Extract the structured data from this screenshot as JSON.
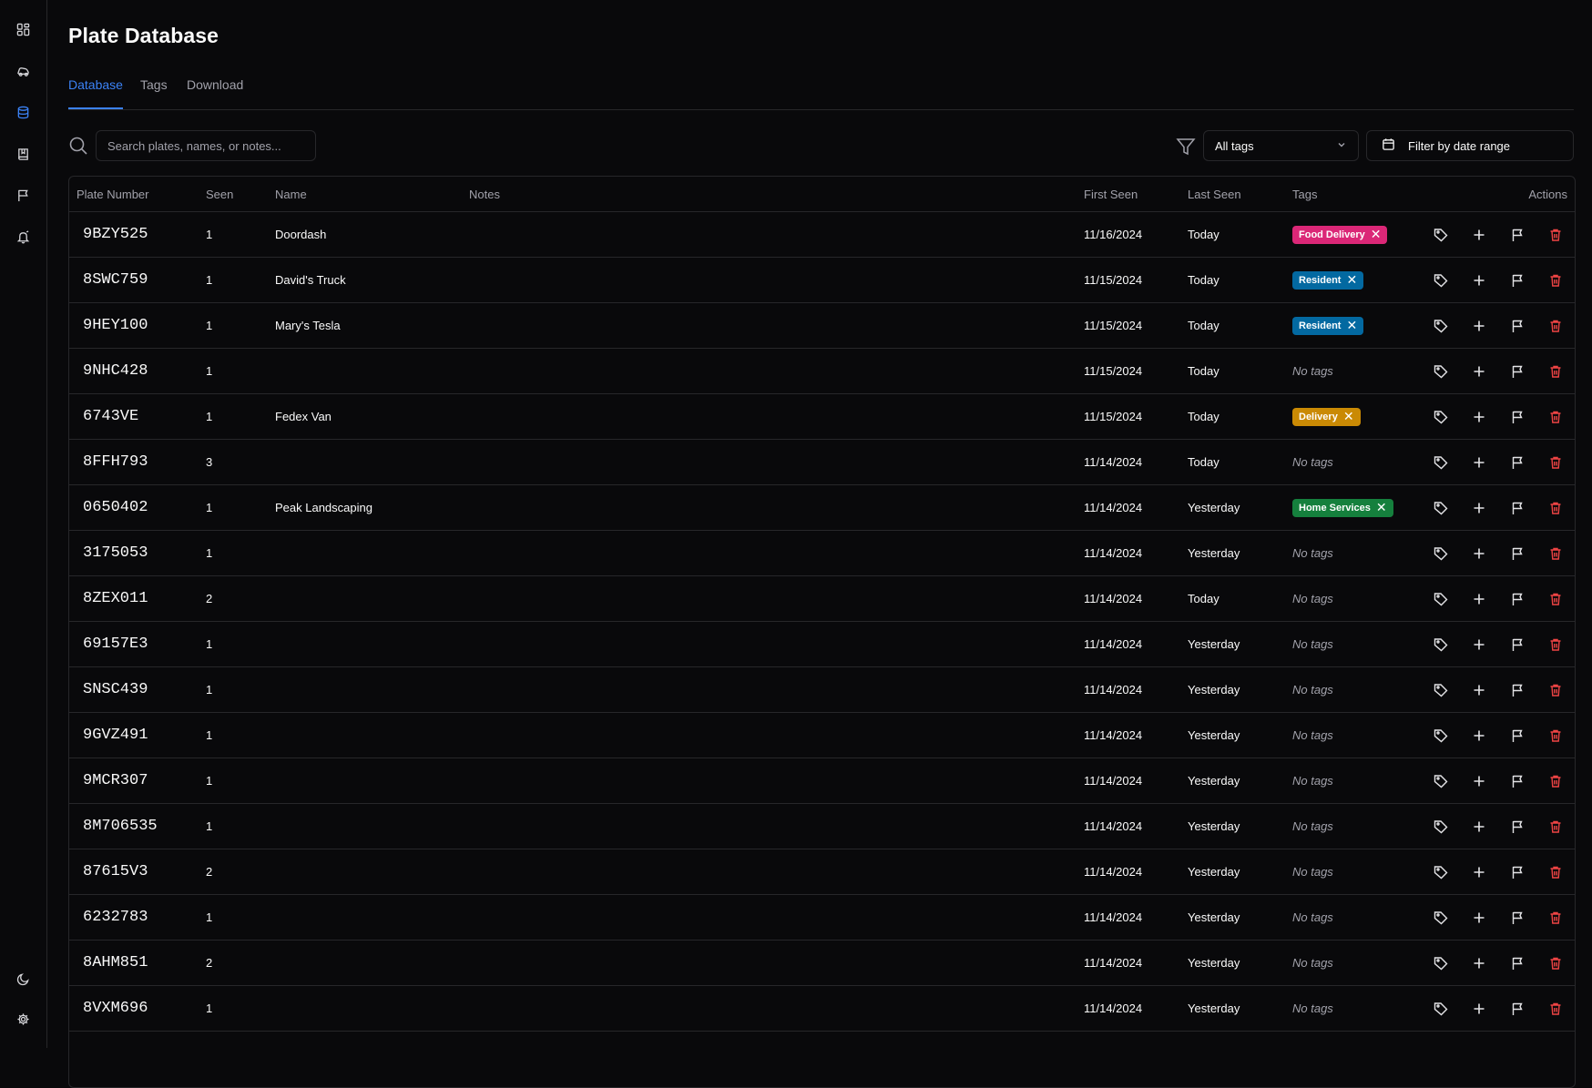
{
  "page": {
    "title": "Plate Database"
  },
  "tabs": [
    {
      "label": "Database",
      "active": true
    },
    {
      "label": "Tags",
      "active": false
    },
    {
      "label": "Download",
      "active": false
    }
  ],
  "search": {
    "placeholder": "Search plates, names, or notes...",
    "value": ""
  },
  "filters": {
    "tag_select_value": "All tags",
    "date_button_label": "Filter by date range"
  },
  "table": {
    "columns": [
      "Plate Number",
      "Seen",
      "Name",
      "Notes",
      "First Seen",
      "Last Seen",
      "Tags",
      "Actions"
    ],
    "no_tags_label": "No tags",
    "rows": [
      {
        "plate": "9BZY525",
        "seen": "1",
        "name": "Doordash",
        "notes": "",
        "first_seen": "11/16/2024",
        "last_seen": "Today",
        "tags": [
          {
            "name": "Food Delivery",
            "color": "#db2777"
          }
        ]
      },
      {
        "plate": "8SWC759",
        "seen": "1",
        "name": "David's Truck",
        "notes": "",
        "first_seen": "11/15/2024",
        "last_seen": "Today",
        "tags": [
          {
            "name": "Resident",
            "color": "#0369a1"
          }
        ]
      },
      {
        "plate": "9HEY100",
        "seen": "1",
        "name": "Mary's Tesla",
        "notes": "",
        "first_seen": "11/15/2024",
        "last_seen": "Today",
        "tags": [
          {
            "name": "Resident",
            "color": "#0369a1"
          }
        ]
      },
      {
        "plate": "9NHC428",
        "seen": "1",
        "name": "",
        "notes": "",
        "first_seen": "11/15/2024",
        "last_seen": "Today",
        "tags": []
      },
      {
        "plate": "6743VE",
        "seen": "1",
        "name": "Fedex Van",
        "notes": "",
        "first_seen": "11/15/2024",
        "last_seen": "Today",
        "tags": [
          {
            "name": "Delivery",
            "color": "#ca8a04"
          }
        ]
      },
      {
        "plate": "8FFH793",
        "seen": "3",
        "name": "",
        "notes": "",
        "first_seen": "11/14/2024",
        "last_seen": "Today",
        "tags": []
      },
      {
        "plate": "0650402",
        "seen": "1",
        "name": "Peak Landscaping",
        "notes": "",
        "first_seen": "11/14/2024",
        "last_seen": "Yesterday",
        "tags": [
          {
            "name": "Home Services",
            "color": "#15803d"
          }
        ]
      },
      {
        "plate": "3175053",
        "seen": "1",
        "name": "",
        "notes": "",
        "first_seen": "11/14/2024",
        "last_seen": "Yesterday",
        "tags": []
      },
      {
        "plate": "8ZEX011",
        "seen": "2",
        "name": "",
        "notes": "",
        "first_seen": "11/14/2024",
        "last_seen": "Today",
        "tags": []
      },
      {
        "plate": "69157E3",
        "seen": "1",
        "name": "",
        "notes": "",
        "first_seen": "11/14/2024",
        "last_seen": "Yesterday",
        "tags": []
      },
      {
        "plate": "SNSC439",
        "seen": "1",
        "name": "",
        "notes": "",
        "first_seen": "11/14/2024",
        "last_seen": "Yesterday",
        "tags": []
      },
      {
        "plate": "9GVZ491",
        "seen": "1",
        "name": "",
        "notes": "",
        "first_seen": "11/14/2024",
        "last_seen": "Yesterday",
        "tags": []
      },
      {
        "plate": "9MCR307",
        "seen": "1",
        "name": "",
        "notes": "",
        "first_seen": "11/14/2024",
        "last_seen": "Yesterday",
        "tags": []
      },
      {
        "plate": "8M706535",
        "seen": "1",
        "name": "",
        "notes": "",
        "first_seen": "11/14/2024",
        "last_seen": "Yesterday",
        "tags": []
      },
      {
        "plate": "87615V3",
        "seen": "2",
        "name": "",
        "notes": "",
        "first_seen": "11/14/2024",
        "last_seen": "Yesterday",
        "tags": []
      },
      {
        "plate": "6232783",
        "seen": "1",
        "name": "",
        "notes": "",
        "first_seen": "11/14/2024",
        "last_seen": "Yesterday",
        "tags": []
      },
      {
        "plate": "8AHM851",
        "seen": "2",
        "name": "",
        "notes": "",
        "first_seen": "11/14/2024",
        "last_seen": "Yesterday",
        "tags": []
      },
      {
        "plate": "8VXM696",
        "seen": "1",
        "name": "",
        "notes": "",
        "first_seen": "11/14/2024",
        "last_seen": "Yesterday",
        "tags": []
      }
    ]
  },
  "icons": {
    "sidebar_top": [
      "dashboard-icon",
      "car-icon",
      "database-icon",
      "book-icon",
      "flag-icon",
      "bell-icon"
    ],
    "sidebar_bottom": [
      "moon-icon",
      "gear-icon"
    ],
    "row_actions": [
      "tag-icon",
      "plus-icon",
      "flag-icon",
      "trash-icon"
    ]
  },
  "colors": {
    "accent": "#3b82f6",
    "delete": "#ef4444",
    "background": "#09090b",
    "border": "#27272a"
  }
}
